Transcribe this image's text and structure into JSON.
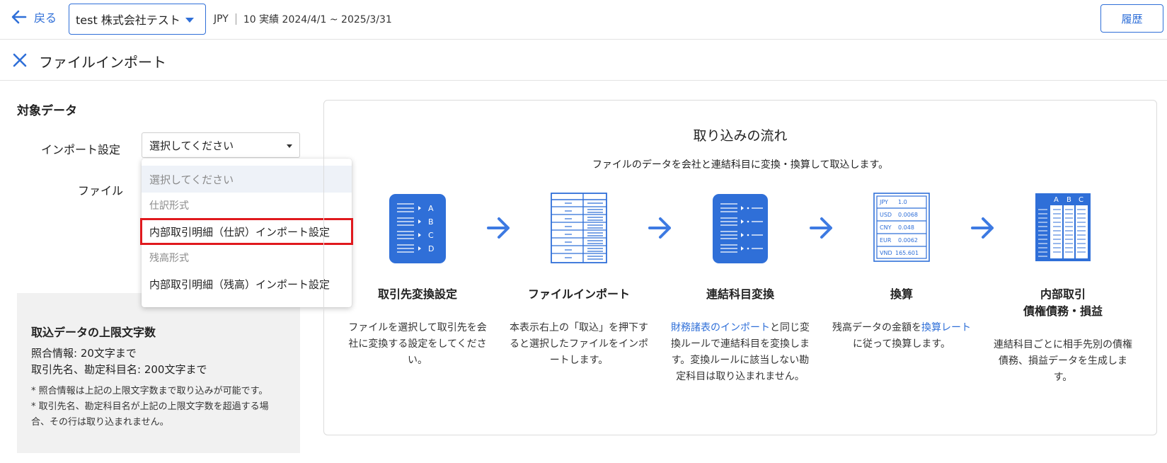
{
  "topbar": {
    "back_label": "戻る",
    "company": "test 株式会社テスト",
    "currency": "JPY",
    "period": "10 実績 2024/4/1 ~ 2025/3/31",
    "history_label": "履歴"
  },
  "page": {
    "title": "ファイルインポート"
  },
  "form": {
    "section_title": "対象データ",
    "import_label": "インポート設定",
    "file_label": "ファイル",
    "select_value": "選択してください"
  },
  "menu": {
    "placeholder": "選択してください",
    "group1": "仕訳形式",
    "item1": "内部取引明細（仕訳）インポート設定",
    "group2": "残高形式",
    "item2": "内部取引明細（残高）インポート設定"
  },
  "info": {
    "title": "取込データの上限文字数",
    "line1": "照合情報: 20文字まで",
    "line2": "取引先名、勘定科目名: 200文字まで",
    "note1": "* 照合情報は上記の上限文字数まで取り込みが可能です。",
    "note2": "* 取引先名、勘定科目名が上記の上限文字数を超過する場合、その行は取り込まれません。"
  },
  "flow": {
    "title": "取り込みの流れ",
    "subtitle": "ファイルのデータを会社と連結科目に変換・換算して取込します。",
    "steps": [
      {
        "name": "取引先変換設定",
        "desc": "ファイルを選択して取引先を会社に変換する設定をしてください。"
      },
      {
        "name": "ファイルインポート",
        "desc": "本表示右上の「取込」を押下すると選択したファイルをインポートします。"
      },
      {
        "name": "連結科目変換",
        "desc_link": "財務諸表のインポート",
        "desc_rest": "と同じ変換ルールで連結科目を変換します。変換ルールに該当しない勘定科目は取り込まれません。"
      },
      {
        "name": "換算",
        "desc_pre": "残高データの金額を",
        "desc_link": "換算レート",
        "desc_rest": "に従って換算します。"
      },
      {
        "name1": "内部取引",
        "name2": "債権債務・損益",
        "desc": "連結科目ごとに相手先別の債権債務、損益データを生成します。"
      }
    ],
    "icon_db_letters": [
      "A",
      "B",
      "C",
      "D"
    ],
    "icon_rates": [
      {
        "cur": "JPY",
        "val": "1.0"
      },
      {
        "cur": "USD",
        "val": "0.0068"
      },
      {
        "cur": "CNY",
        "val": "0.048"
      },
      {
        "cur": "EUR",
        "val": "0.0062"
      },
      {
        "cur": "VND",
        "val": "165.601"
      }
    ],
    "icon_sheet_cols": [
      "A",
      "B",
      "C"
    ]
  },
  "colors": {
    "accent": "#2f6fd8",
    "highlight": "#e0191e",
    "info_bg": "#f1f1f1"
  }
}
